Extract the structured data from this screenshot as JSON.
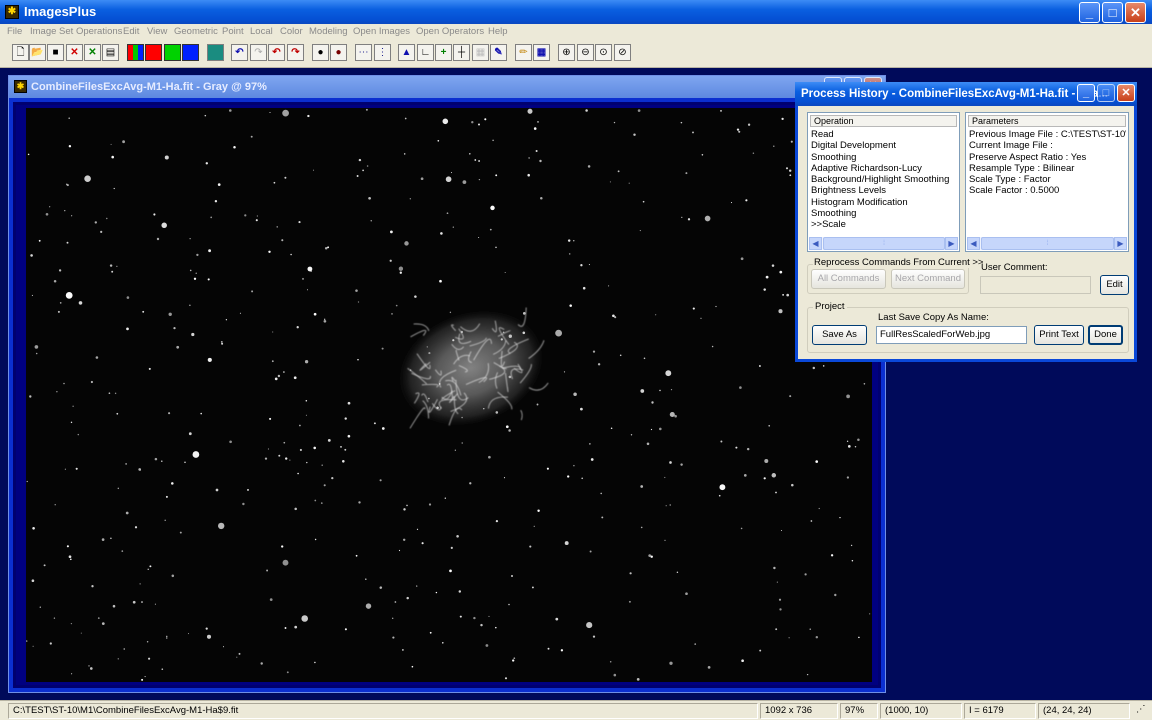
{
  "app": {
    "title": "ImagesPlus",
    "icon": "app-logo-icon"
  },
  "menu": [
    "File",
    "Image Set Operations",
    "Edit",
    "View",
    "Geometric",
    "Point",
    "Local",
    "Color",
    "Modeling",
    "Open Images",
    "Open Operators",
    "Help"
  ],
  "toolbar": {
    "buttons": [
      "new-file",
      "open-file",
      "save",
      "close-red-x",
      "close-all-green-x",
      "print",
      "rgb-color",
      "red-channel",
      "green-channel",
      "blue-channel",
      "grid-view",
      "undo",
      "redo-disabled",
      "undo-all",
      "redo-all",
      "dark-dot",
      "dark-dot-red",
      "dotted-line",
      "dotted-select",
      "histogram",
      "curves",
      "add-crosshair",
      "crosshair",
      "grid-disabled",
      "color-picker",
      "pencil",
      "table",
      "zoom-in",
      "zoom-out",
      "zoom-fit",
      "zoom-reset"
    ]
  },
  "image_window": {
    "title": "CombineFilesExcAvg-M1-Ha.fit - Gray @ 97%"
  },
  "process_history": {
    "title": "Process History - CombineFilesExcAvg-M1-Ha.fit - Gra...",
    "operation_header": "Operation",
    "operations": [
      "Read",
      "Digital Development",
      "Smoothing",
      "Adaptive Richardson-Lucy",
      "Background/Highlight Smoothing",
      "Brightness Levels",
      "Histogram Modification",
      "Smoothing",
      ">>Scale"
    ],
    "parameters_header": "Parameters",
    "parameters": [
      "Previous Image File : C:\\TEST\\ST-10\\...",
      "Current Image File :",
      "Preserve Aspect Ratio : Yes",
      "Resample Type : Bilinear",
      "Scale Type : Factor",
      "Scale Factor : 0.5000"
    ],
    "reprocess_label": "Reprocess Commands From Current >>",
    "all_commands": "All Commands",
    "next_command": "Next Command",
    "user_comment_label": "User Comment:",
    "user_comment_value": "",
    "edit_button": "Edit",
    "project_label": "Project",
    "save_as_button": "Save As",
    "last_save_label": "Last Save Copy As Name:",
    "last_save_value": "FullResScaledForWeb.jpg",
    "print_text_button": "Print Text",
    "done_button": "Done"
  },
  "statusbar": {
    "path": "C:\\TEST\\ST-10\\M1\\CombineFilesExcAvg-M1-Ha$9.fit",
    "dimensions": "1092 x 736",
    "zoom": "97%",
    "cursor": "(1000, 10)",
    "intensity": "I = 6179",
    "rgb": "(24, 24, 24)"
  }
}
